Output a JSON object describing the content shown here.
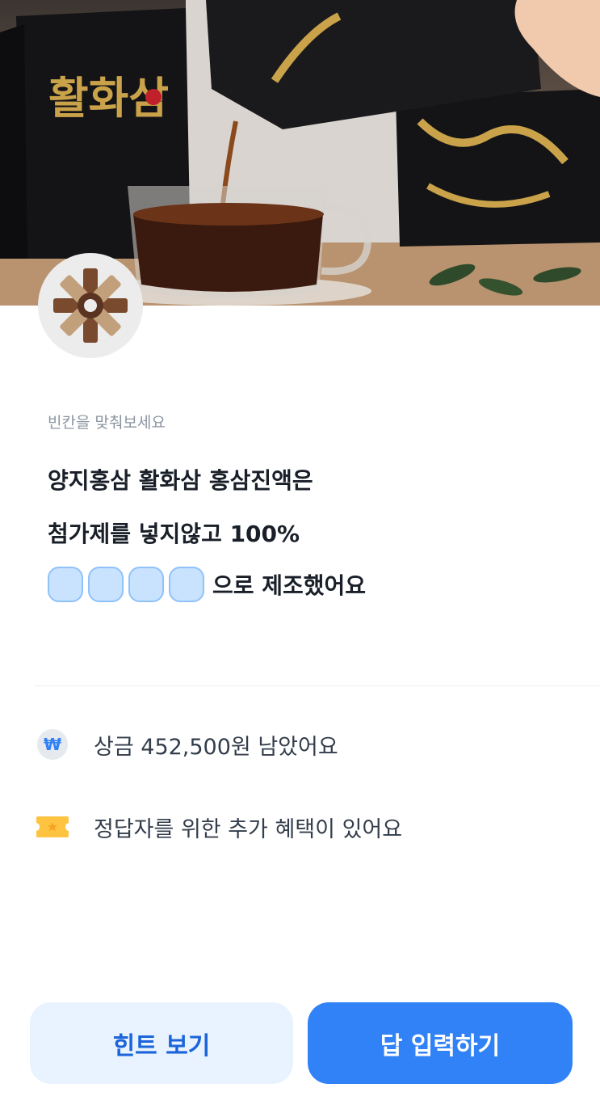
{
  "hero": {
    "image": "red-ginseng-product-photo",
    "brand_text": "활화삼"
  },
  "brand": {
    "logo": "brand-logo-icon"
  },
  "quiz": {
    "prompt": "빈칸을 맞춰보세요",
    "line1": "양지홍삼 활화삼 홍삼진액은",
    "line2": "첨가제를 넣지않고 100%",
    "blank_count": 4,
    "line3_suffix": "으로 제조했어요"
  },
  "info": {
    "prize": {
      "icon": "won-icon",
      "text": "상금 452,500원 남았어요"
    },
    "benefit": {
      "icon": "ticket-icon",
      "text": "정답자를 위한 추가 혜택이 있어요"
    }
  },
  "buttons": {
    "hint": "힌트 보기",
    "answer": "답 입력하기"
  },
  "colors": {
    "primary": "#3182f6",
    "primary_light": "#e8f3ff",
    "blank_fill": "#c9e2fd",
    "blank_border": "#90c2fa",
    "ticket": "#ffc342"
  }
}
